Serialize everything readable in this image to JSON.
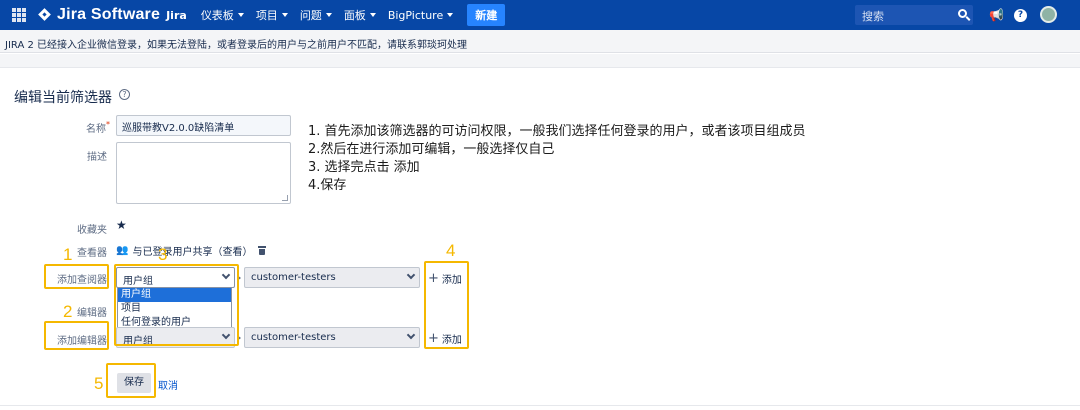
{
  "nav": {
    "logo_text": "Jira Software",
    "logo_sub": "Jira",
    "menu": [
      {
        "label": "仪表板"
      },
      {
        "label": "项目"
      },
      {
        "label": "问题"
      },
      {
        "label": "面板"
      },
      {
        "label": "BigPicture"
      }
    ],
    "create_label": "新建",
    "search_placeholder": "搜索",
    "help_glyph": "?",
    "notification_glyph": "📢",
    "colors": {
      "nav_bg": "#0747a6",
      "create_bg": "#2684ff"
    }
  },
  "banner": {
    "text": "JIRA 2 已经接入企业微信登录，如果无法登陆，或者登录后的用户与之前用户不匹配，请联系郭琰珂处理"
  },
  "page": {
    "title": "编辑当前筛选器",
    "help_glyph": "?"
  },
  "form": {
    "name_label": "名称",
    "required_mark": "*",
    "name_value": "巡服带教V2.0.0缺陷清单",
    "description_label": "描述",
    "description_value": "",
    "favourite_label": "收藏夹",
    "favourite_glyph": "★",
    "viewers_label": "查看器",
    "viewer_share_text": "与已登录用户共享（查看）",
    "add_viewer_label": "添加查阅器",
    "viewer_type_value": "用户组",
    "viewer_group_value": "customer-testers",
    "add_label": "添加",
    "plus_glyph": "+",
    "editors_label": "编辑器",
    "add_editor_label": "添加编辑器",
    "editor_type_value": "用户组",
    "editor_group_value": "customer-testers",
    "dropdown_options": [
      "用户组",
      "项目",
      "任何登录的用户"
    ],
    "save_label": "保存",
    "cancel_label": "取消"
  },
  "instructions": [
    "1. 首先添加该筛选器的可访问权限，一般我们选择任何登录的用户，或者该项目组成员",
    "2.然后在进行添加可编辑，一般选择仅自己",
    "3. 选择完点击 添加",
    "4.保存"
  ],
  "annotations": {
    "color": "#f5b800",
    "numbers": [
      "1",
      "2",
      "3",
      "4",
      "5"
    ]
  }
}
